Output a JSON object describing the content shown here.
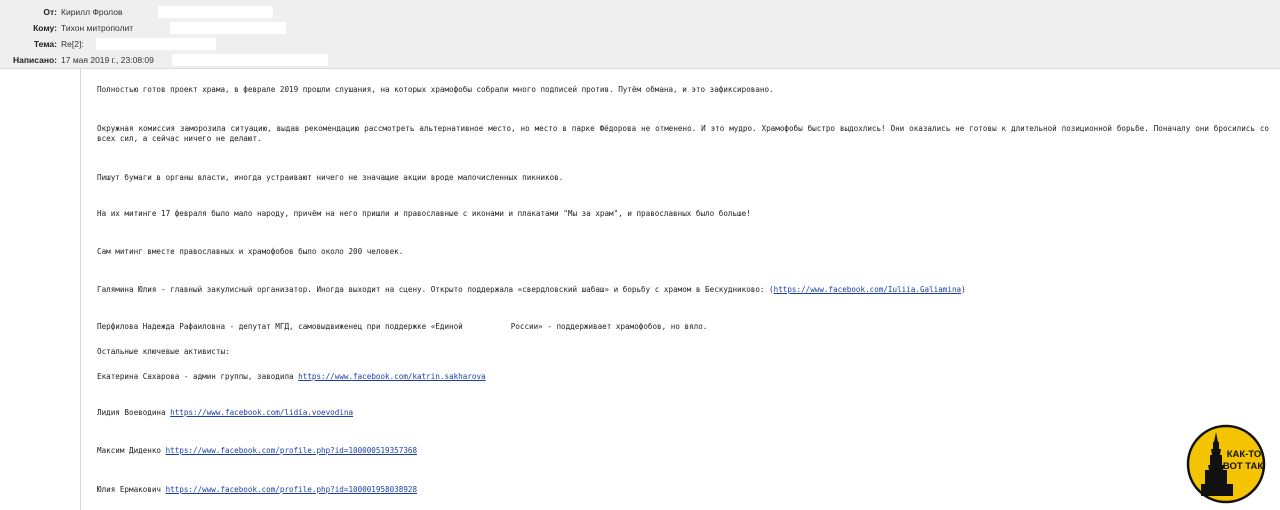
{
  "header": {
    "from_label": "От:",
    "from_value": "Кирилл Фролов",
    "to_label": "Кому:",
    "to_value": "Тихон митрополит",
    "subject_label": "Тема:",
    "subject_value": "Re[2]:",
    "date_label": "Написано:",
    "date_value": "17 мая 2019 г., 23:08:09"
  },
  "message": {
    "p1": "Полностью готов проект храма, в феврале 2019 прошли слушания, на которых храмофобы собрали много подписей против. Путём обмана, и это зафиксировано.",
    "p2": "Окружная комиссия заморозила ситуацию, выдав рекомендацию рассмотреть альтернативное место, но место в парке Фёдорова не отменено. И это мудро. Храмофобы быстро выдохлись! Они оказались не готовы к длительной позиционной борьбе. Поначалу они бросились со всех сил, а сейчас ничего не делают.",
    "p3": "Пишут бумаги в органы власти, иногда устраивают ничего не значащие акции вроде малочисленных пикников.",
    "p4": "На их митинге 17 февраля было мало народу, причём на него пришли и православные с иконами и плакатами \"Мы за храм\", и православных было больше!",
    "p5": "Сам митинг вместе православных и храмофобов было около 200 человек.",
    "p6_text": "Галямина Юлия - главный закулисный организатор. Иногда выходит на сцену. Открыто поддержала «свердловский шабаш» и борьбу с храмом в Бескудниково: (",
    "p6_link": "https://www.facebook.com/Iuliia.Galiamina",
    "p6_end": ")",
    "p7_a": "Перфилова Надежда Рафаиловна - депутат МГД, самовыдвиженец при поддержке «Единой",
    "p7_b": "России» - поддерживает храмофобов, но вяло.",
    "p8": "Остальные ключевые активисты:",
    "activists": [
      {
        "name": "Екатерина Сахарова - админ группы, заводила ",
        "link": "https://www.facebook.com/katrin.sakharova"
      },
      {
        "name": "Лидия Воеводина ",
        "link": "https://www.facebook.com/lidia.voevodina"
      },
      {
        "name": "Максим Диденко ",
        "link": "https://www.facebook.com/profile.php?id=100000519357368"
      },
      {
        "name": "Юлия Ермакович ",
        "link": "https://www.facebook.com/profile.php?id=100001958038928"
      }
    ]
  },
  "logo": {
    "line1": "КАК-ТО",
    "line2": "ВОТ ТАК",
    "color": "#f5c400"
  }
}
